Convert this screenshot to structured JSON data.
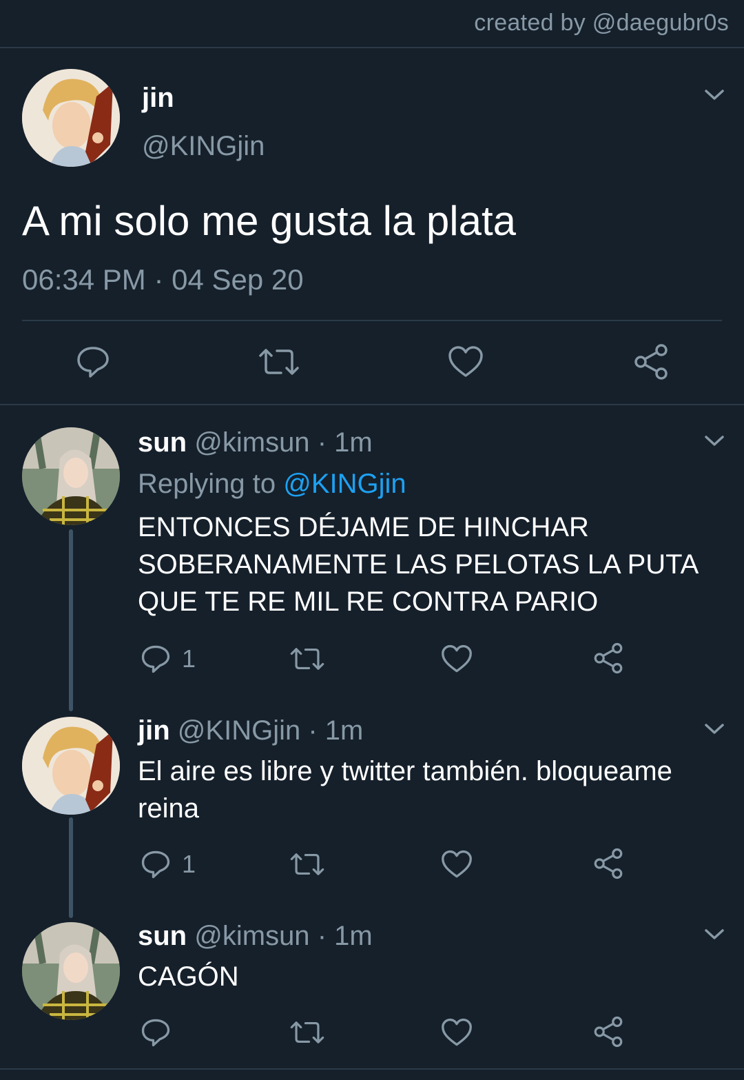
{
  "credit": "created by @daegubr0s",
  "main_tweet": {
    "name": "jin",
    "handle": "@KINGjin",
    "text": "A mi solo me gusta la plata",
    "timestamp": "06:34 PM · 04 Sep 20",
    "avatar_icon": "avatar-jin",
    "actions": [
      "reply-icon",
      "retweet-icon",
      "like-icon",
      "share-icon"
    ]
  },
  "replies": [
    {
      "name": "sun",
      "handle": "@kimsun",
      "time": "· 1m",
      "replying_prefix": "Replying to",
      "replying_to": "@KINGjin",
      "text": "ENTONCES DÉJAME DE HINCHAR SOBERANAMENTE LAS PELOTAS LA PUTA QUE TE RE MIL RE CONTRA PARIO",
      "reply_count": "1"
    },
    {
      "name": "jin",
      "handle": "@KINGjin",
      "time": "· 1m",
      "text": "El aire es libre y twitter también. bloqueame reina",
      "reply_count": "1"
    },
    {
      "name": "sun",
      "handle": "@kimsun",
      "time": "· 1m",
      "text": "CAGÓN",
      "reply_count": ""
    }
  ],
  "colors": {
    "background": "#15202b",
    "secondary_text": "#8899a6",
    "link": "#1da1f2",
    "divider": "#2c3a47"
  }
}
